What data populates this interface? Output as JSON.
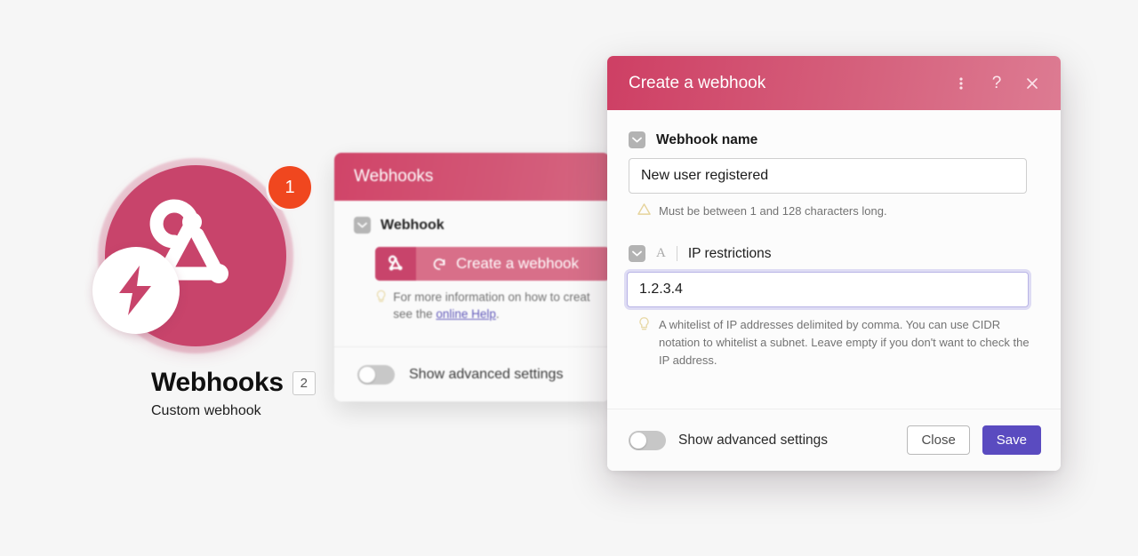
{
  "page": {
    "background_color": "#f6f6f6"
  },
  "logo": {
    "app_icon_name": "webhooks-logo",
    "bolt_badge_icon": "lightning-bolt-icon",
    "count_badge": "1",
    "title": "Webhooks",
    "title_badge": "2",
    "subtitle": "Custom webhook",
    "colors": {
      "circle": "#c8446b",
      "badge": "#f0471f",
      "halo": "#e3a8bb"
    }
  },
  "background_panel": {
    "header_title": "Webhooks",
    "section_label": "Webhook",
    "create_button_label": "Create a webhook",
    "create_button_icon": "webhook-icon",
    "create_button_refresh_icon": "refresh-icon",
    "hint_text_before": "For more information on how to creat",
    "hint_text_second_line": "see the ",
    "hint_link": "online Help",
    "hint_text_after": ".",
    "hint_icon": "lightbulb-icon",
    "footer_toggle_label": "Show advanced settings",
    "footer_toggle_state": "off"
  },
  "dialog": {
    "title": "Create a webhook",
    "header_icons": [
      {
        "name": "kebab-menu-icon",
        "glyph": "⋮"
      },
      {
        "name": "help-icon",
        "glyph": "?"
      },
      {
        "name": "close-icon",
        "glyph": "×"
      }
    ],
    "fields": [
      {
        "label": "Webhook name",
        "checkbox_icon": "chevron-down-icon",
        "value": "New user registered",
        "placeholder": "Webhook name",
        "hint": "Must be between 1 and 128 characters long.",
        "hint_icon": "warning-triangle-icon",
        "focused": false
      },
      {
        "label": "IP restrictions",
        "checkbox_icon": "chevron-down-icon",
        "type_indicator": "A",
        "value": "1.2.3.4",
        "placeholder": "IP restrictions",
        "hint": "A whitelist of IP addresses delimited by comma. You can use CIDR notation to whitelist a subnet. Leave empty if you don't want to check the IP address.",
        "hint_icon": "lightbulb-icon",
        "focused": true
      }
    ],
    "footer": {
      "toggle_label": "Show advanced settings",
      "toggle_state": "off",
      "close_label": "Close",
      "save_label": "Save",
      "save_color": "#5a4bc0"
    }
  }
}
